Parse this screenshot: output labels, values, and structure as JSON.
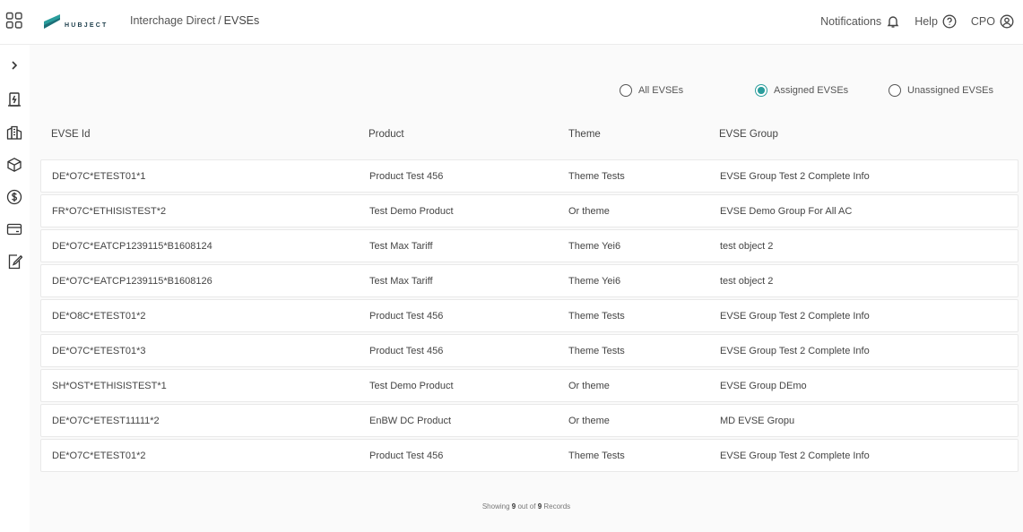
{
  "header": {
    "logo_text": "HUBJECT",
    "breadcrumb": {
      "parent": "Interchage Direct",
      "separator": "/",
      "current": "EVSEs"
    },
    "notifications_label": "Notifications",
    "help_label": "Help",
    "user_label": "CPO",
    "accent_color": "#2a9d9c"
  },
  "sidebar": {
    "items": [
      {
        "icon": "chevron-right-icon"
      },
      {
        "icon": "charging-station-icon"
      },
      {
        "icon": "building-icon"
      },
      {
        "icon": "package-icon"
      },
      {
        "icon": "dollar-icon"
      },
      {
        "icon": "card-icon"
      },
      {
        "icon": "contract-edit-icon"
      }
    ]
  },
  "filters": {
    "options": [
      {
        "label": "All EVSEs",
        "checked": false
      },
      {
        "label": "Assigned EVSEs",
        "checked": true
      },
      {
        "label": "Unassigned EVSEs",
        "checked": false
      }
    ]
  },
  "table": {
    "columns": [
      "EVSE Id",
      "Product",
      "Theme",
      "EVSE Group"
    ],
    "rows": [
      [
        "DE*O7C*ETEST01*1",
        "Product Test 456",
        "Theme Tests",
        "EVSE Group Test 2 Complete Info"
      ],
      [
        "FR*O7C*ETHISISTEST*2",
        "Test Demo Product",
        "Or theme",
        "EVSE Demo Group For All AC"
      ],
      [
        "DE*O7C*EATCP1239115*B1608124",
        "Test Max Tariff",
        "Theme Yei6",
        "test object 2"
      ],
      [
        "DE*O7C*EATCP1239115*B1608126",
        "Test Max Tariff",
        "Theme Yei6",
        "test object 2"
      ],
      [
        "DE*O8C*ETEST01*2",
        "Product Test 456",
        "Theme Tests",
        "EVSE Group Test 2 Complete Info"
      ],
      [
        "DE*O7C*ETEST01*3",
        "Product Test 456",
        "Theme Tests",
        "EVSE Group Test 2 Complete Info"
      ],
      [
        "SH*OST*ETHISISTEST*1",
        "Test Demo Product",
        "Or theme",
        "EVSE Group DEmo"
      ],
      [
        "DE*O7C*ETEST11111*2",
        "EnBW DC Product",
        "Or theme",
        "MD EVSE Gropu"
      ],
      [
        "DE*O7C*ETEST01*2",
        "Product Test 456",
        "Theme Tests",
        "EVSE Group Test 2 Complete Info"
      ]
    ]
  },
  "footer": {
    "prefix": "Showing",
    "shown": "9",
    "middle": "out of",
    "total": "9",
    "suffix": "Records"
  }
}
